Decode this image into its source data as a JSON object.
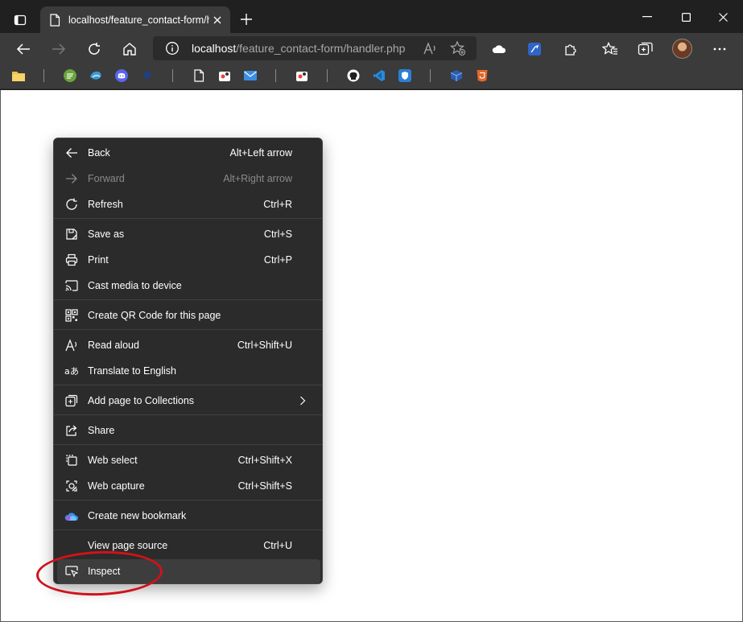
{
  "tab": {
    "title": "localhost/feature_contact-form/handler.php"
  },
  "address": {
    "host": "localhost",
    "path": "/feature_contact-form/handler.php"
  },
  "favorites": [
    "folder",
    "feedly",
    "edge-dev",
    "discord",
    "app",
    "page",
    "extension-a",
    "mail",
    "extension-b",
    "github",
    "vscode",
    "bitwarden",
    "cube",
    "html5"
  ],
  "menu": {
    "items": [
      {
        "id": "back",
        "label": "Back",
        "shortcut": "Alt+Left arrow",
        "icon": "arrow-left-icon",
        "disabled": false
      },
      {
        "id": "forward",
        "label": "Forward",
        "shortcut": "Alt+Right arrow",
        "icon": "arrow-right-icon",
        "disabled": true
      },
      {
        "id": "refresh",
        "label": "Refresh",
        "shortcut": "Ctrl+R",
        "icon": "refresh-icon",
        "disabled": false
      },
      {
        "id": "save-as",
        "label": "Save as",
        "shortcut": "Ctrl+S",
        "icon": "save-icon",
        "disabled": false
      },
      {
        "id": "print",
        "label": "Print",
        "shortcut": "Ctrl+P",
        "icon": "print-icon",
        "disabled": false
      },
      {
        "id": "cast",
        "label": "Cast media to device",
        "shortcut": "",
        "icon": "cast-icon",
        "disabled": false
      },
      {
        "id": "qr",
        "label": "Create QR Code for this page",
        "shortcut": "",
        "icon": "qr-code-icon",
        "disabled": false
      },
      {
        "id": "read-aloud",
        "label": "Read aloud",
        "shortcut": "Ctrl+Shift+U",
        "icon": "read-aloud-icon",
        "disabled": false
      },
      {
        "id": "translate",
        "label": "Translate to English",
        "shortcut": "",
        "icon": "translate-icon",
        "disabled": false
      },
      {
        "id": "collections",
        "label": "Add page to Collections",
        "shortcut": "",
        "icon": "collections-icon",
        "disabled": false,
        "submenu": true
      },
      {
        "id": "share",
        "label": "Share",
        "shortcut": "",
        "icon": "share-icon",
        "disabled": false
      },
      {
        "id": "web-select",
        "label": "Web select",
        "shortcut": "Ctrl+Shift+X",
        "icon": "web-select-icon",
        "disabled": false
      },
      {
        "id": "web-capture",
        "label": "Web capture",
        "shortcut": "Ctrl+Shift+S",
        "icon": "web-capture-icon",
        "disabled": false
      },
      {
        "id": "bookmark",
        "label": "Create new bookmark",
        "shortcut": "",
        "icon": "cloud-bookmark-icon",
        "disabled": false
      },
      {
        "id": "view-source",
        "label": "View page source",
        "shortcut": "Ctrl+U",
        "icon": "",
        "disabled": false
      },
      {
        "id": "inspect",
        "label": "Inspect",
        "shortcut": "",
        "icon": "inspect-icon",
        "disabled": false,
        "highlighted": true
      }
    ]
  },
  "colors": {
    "menu_bg": "#2b2b2b",
    "highlight": "#3d3d3d",
    "annotation": "#d0121b",
    "disabled_text": "#8a8a8a"
  }
}
